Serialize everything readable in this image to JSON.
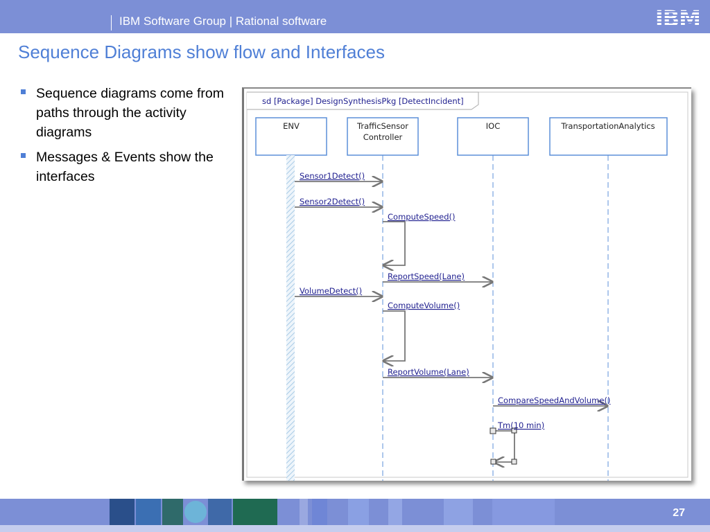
{
  "header": {
    "text": "IBM Software Group | Rational software",
    "logo": "IBM",
    "band_color": "#7c8fd6"
  },
  "title": "Sequence Diagrams show flow and Interfaces",
  "bullets": [
    "Sequence diagrams come from paths through the activity diagrams",
    "Messages & Events show the interfaces"
  ],
  "diagram": {
    "frame_label": "sd [Package] DesignSynthesisPkg [DetectIncident]",
    "lifelines": [
      {
        "name_lines": [
          "ENV"
        ]
      },
      {
        "name_lines": [
          "TrafficSensor",
          "Controller"
        ]
      },
      {
        "name_lines": [
          "IOC"
        ]
      },
      {
        "name_lines": [
          "TransportationAnalytics"
        ]
      }
    ],
    "messages": [
      {
        "label": "Sensor1Detect()",
        "from": "ENV",
        "to": "TrafficSensor Controller"
      },
      {
        "label": "Sensor2Detect()",
        "from": "ENV",
        "to": "TrafficSensor Controller"
      },
      {
        "label": "ComputeSpeed()",
        "from": "TrafficSensor Controller",
        "to": "TrafficSensor Controller"
      },
      {
        "label": "ReportSpeed(Lane)",
        "from": "TrafficSensor Controller",
        "to": "IOC"
      },
      {
        "label": "VolumeDetect()",
        "from": "ENV",
        "to": "TrafficSensor Controller"
      },
      {
        "label": "ComputeVolume()",
        "from": "TrafficSensor Controller",
        "to": "TrafficSensor Controller"
      },
      {
        "label": "ReportVolume(Lane)",
        "from": "TrafficSensor Controller",
        "to": "IOC"
      },
      {
        "label": "CompareSpeedAndVolume()",
        "from": "IOC",
        "to": "TransportationAnalytics"
      },
      {
        "label": "Tm(10 min)",
        "from": "IOC",
        "to": "IOC"
      }
    ],
    "accent_color": "#1f1f8f",
    "box_border_color": "#5b8fd8"
  },
  "footer": {
    "page_number": "27",
    "band_color": "#7c8fd6"
  }
}
